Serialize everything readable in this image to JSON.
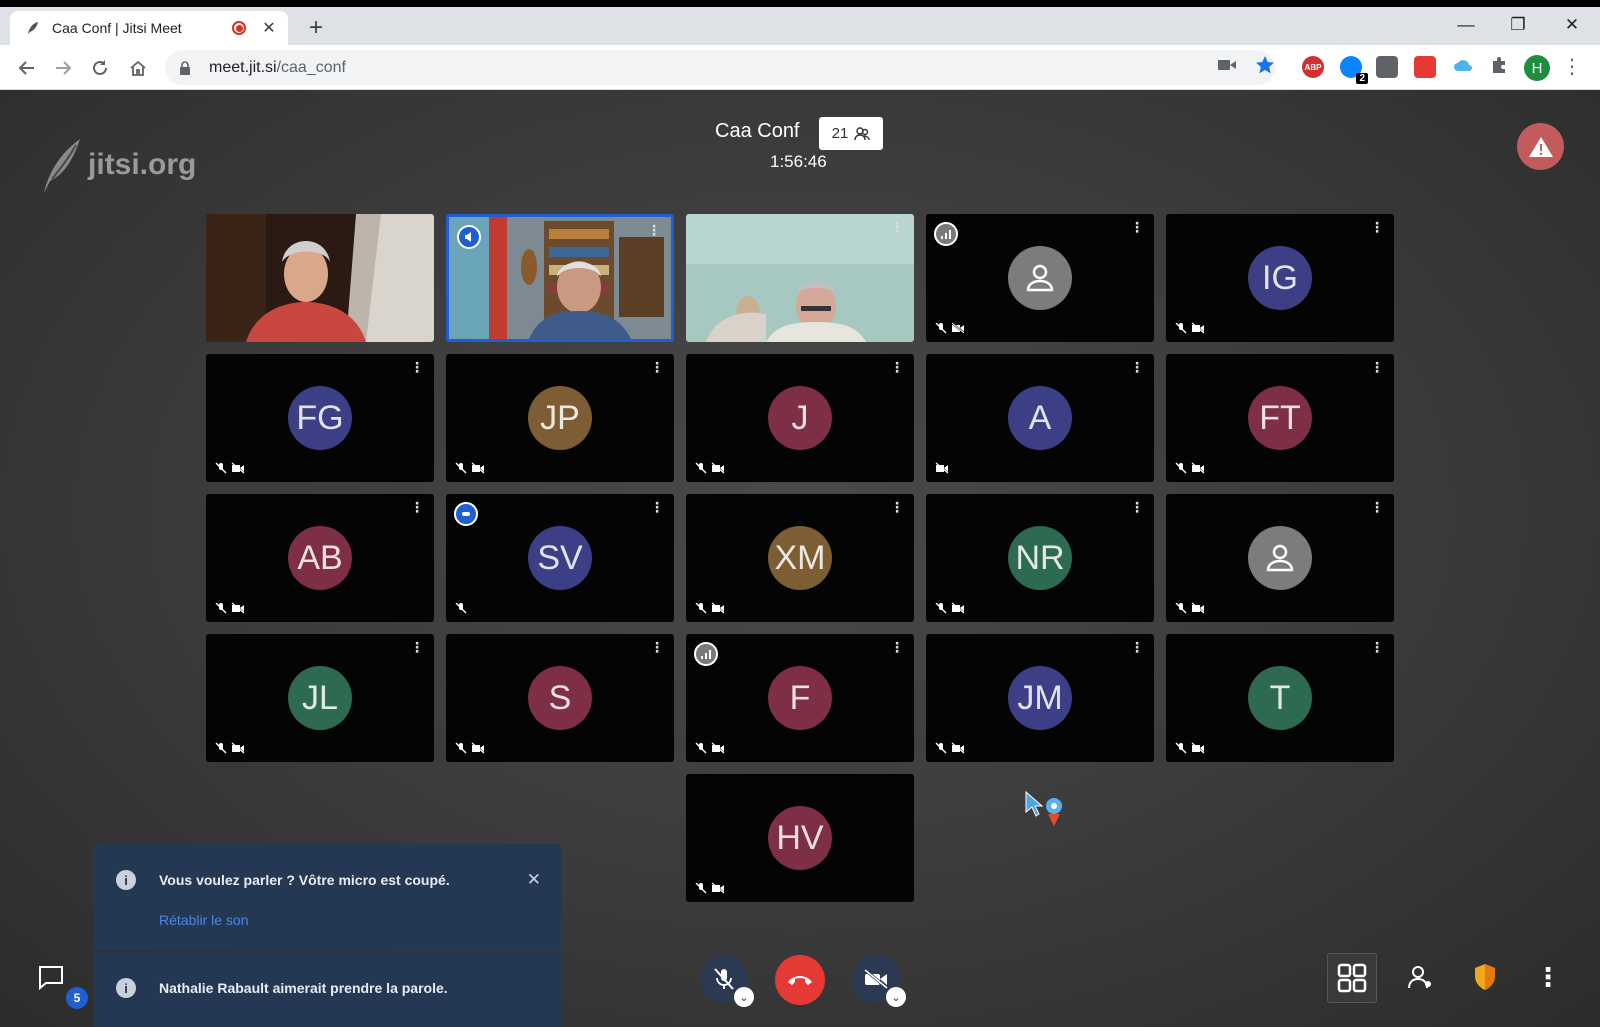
{
  "browser": {
    "tab_title": "Caa Conf | Jitsi Meet",
    "tab_close": "✕",
    "new_tab": "+",
    "url_host": "meet.jit.si",
    "url_path": "/caa_conf",
    "profile_initial": "H",
    "ext_badge": "2",
    "ext_abp": "ABP",
    "minimize": "—",
    "restore": "❐",
    "close": "✕"
  },
  "meeting": {
    "logo_text": "jitsi.org",
    "title": "Caa Conf",
    "participant_count": "21",
    "elapsed": "1:56:46"
  },
  "participants": [
    {
      "initials": "",
      "type": "video"
    },
    {
      "initials": "",
      "type": "video"
    },
    {
      "initials": "",
      "type": "video"
    },
    {
      "initials": "",
      "type": "placeholder"
    },
    {
      "initials": "IG"
    },
    {
      "initials": "FG"
    },
    {
      "initials": "JP"
    },
    {
      "initials": "J"
    },
    {
      "initials": "A"
    },
    {
      "initials": "FT"
    },
    {
      "initials": "AB"
    },
    {
      "initials": "SV"
    },
    {
      "initials": "XM"
    },
    {
      "initials": "NR"
    },
    {
      "initials": "",
      "type": "placeholder"
    },
    {
      "initials": "JL"
    },
    {
      "initials": "S"
    },
    {
      "initials": "F"
    },
    {
      "initials": "JM"
    },
    {
      "initials": "T"
    },
    {
      "initials": "HV"
    }
  ],
  "notifications": {
    "muted_message": "Vous voulez parler ? Vôtre micro est coupé.",
    "unmute_link": "Rétablir le son",
    "raise_hand_message": "Nathalie Rabault aimerait prendre la parole.",
    "info_glyph": "i",
    "close_glyph": "✕"
  },
  "toolbar": {
    "chat_unread": "5"
  },
  "colors": {
    "accent": "#1f5fd1",
    "hangup": "#e53935",
    "notification_bg": "#253853"
  }
}
